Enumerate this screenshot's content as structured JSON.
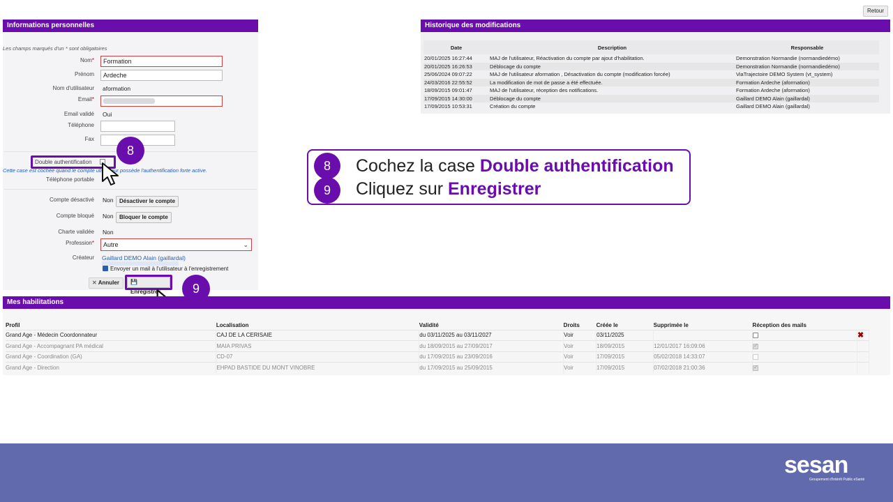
{
  "retour_label": "Retour",
  "personal": {
    "title": "Informations personnelles",
    "required_note": "Les champs marqués d'un * sont obligatoires",
    "nom_label": "Nom",
    "nom_value": "Formation",
    "prenom_label": "Prénom",
    "prenom_value": "Ardeche",
    "username_label": "Nom d'utilisateur",
    "username_value": "aformation",
    "email_label": "Email",
    "email_valide_label": "Email validé",
    "email_valide_value": "Oui",
    "telephone_label": "Téléphone",
    "fax_label": "Fax",
    "double_auth_label": "Double authentification",
    "double_auth_note": "Cette case est cochée quand le compte utilisateur possède l'authentification forte active.",
    "tel_portable_label": "Téléphone portable",
    "compte_desactive_label": "Compte désactivé",
    "compte_desactive_value": "Non",
    "desactiver_btn": "Désactiver le compte",
    "compte_bloque_label": "Compte bloqué",
    "compte_bloque_value": "Non",
    "bloquer_btn": "Bloquer le compte",
    "charte_label": "Charte validée",
    "charte_value": "Non",
    "profession_label": "Profession",
    "profession_value": "Autre",
    "createur_label": "Créateur",
    "createur_value": "Gaillard DEMO Alain (gaillardal)",
    "envoyer_mail_label": "Envoyer un mail à l'utilisateur à l'enregistrement",
    "annuler_btn": "Annuler",
    "enregistrer_btn": "Enregistrer",
    "required_star": "*"
  },
  "history": {
    "title": "Historique des modifications",
    "headers": [
      "Date",
      "Description",
      "Responsable"
    ],
    "rows": [
      [
        "20/01/2025 16:27:44",
        "MAJ de l'utilisateur, Réactivation du compte par ajout d'habilitation.",
        "Demonstration Normandie (normandiedémo)"
      ],
      [
        "20/01/2025 16:26:53",
        "Déblocage du compte",
        "Demonstration Normandie (normandiedémo)"
      ],
      [
        "25/06/2024 09:07:22",
        "MAJ de l'utilisateur aformation , Désactivation du compte (modification forcée)",
        "ViaTrajectoire DEMO System (vt_system)"
      ],
      [
        "24/03/2016 22:55:52",
        "La modification de mot de passe a été effectuée.",
        "Formation Ardeche (aformation)"
      ],
      [
        "18/09/2015 09:01:47",
        "MAJ de l'utilisateur, réception des notifications.",
        "Formation Ardeche (aformation)"
      ],
      [
        "17/09/2015 14:30:00",
        "Déblocage du compte",
        "Gaillard DEMO Alain (gaillardal)"
      ],
      [
        "17/09/2015 10:53:31",
        "Création du compte",
        "Gaillard DEMO Alain (gaillardal)"
      ]
    ]
  },
  "habilitations": {
    "title": "Mes habilitations",
    "headers": [
      "Profil",
      "Localisation",
      "Validité",
      "Droits",
      "Créée le",
      "Supprimée le",
      "Réception des mails"
    ],
    "rows": [
      {
        "profil": "Grand Age - Médecin Coordonnateur",
        "localisation": "CAJ DE LA CERISAIE",
        "validite": "du 03/11/2025 au 03/11/2027",
        "droits": "Voir",
        "creee": "03/11/2025",
        "supprimee": "",
        "mails": false,
        "active": true
      },
      {
        "profil": "Grand Age - Accompagnant PA médical",
        "localisation": "MAIA PRIVAS",
        "validite": "du 18/09/2015 au 27/09/2017",
        "droits": "Voir",
        "creee": "18/09/2015",
        "supprimee": "12/01/2017 16:09:06",
        "mails": true,
        "active": false
      },
      {
        "profil": "Grand Age - Coordination (GA)",
        "localisation": "CD-07",
        "validite": "du 17/09/2015 au 23/09/2016",
        "droits": "Voir",
        "creee": "17/09/2015",
        "supprimee": "05/02/2018 14:33:07",
        "mails": false,
        "active": false
      },
      {
        "profil": "Grand Age - Direction",
        "localisation": "EHPAD BASTIDE DU MONT VINOBRE",
        "validite": "du 17/09/2015 au 25/09/2015",
        "droits": "Voir",
        "creee": "17/09/2015",
        "supprimee": "07/02/2018 21:00:36",
        "mails": true,
        "active": false
      }
    ],
    "delete_glyph": "✖"
  },
  "callout": {
    "step8_number": "8",
    "step8_prefix": "Cochez la case ",
    "step8_bold": "Double authentification",
    "step9_number": "9",
    "step9_prefix": "Cliquez sur ",
    "step9_bold": "Enregistrer"
  },
  "footer": {
    "logo": "sesan",
    "logo_sub": "Groupement d'Intérêt Public eSanté"
  },
  "colors": {
    "accent": "#6a0dad",
    "footer": "#626aae",
    "error_border": "#d04040",
    "link": "#2a5db0"
  },
  "icons": {
    "cursor": "pointer-cursor-icon",
    "save": "floppy-disk-icon",
    "cancel": "close-icon",
    "dropdown": "chevron-down-icon",
    "delete": "delete-x-icon"
  }
}
